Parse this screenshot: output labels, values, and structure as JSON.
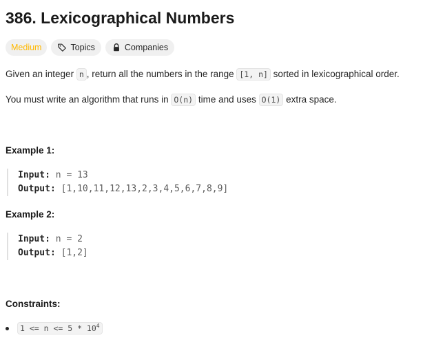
{
  "problem": {
    "title": "386. Lexicographical Numbers",
    "difficulty": "Medium",
    "topics_label": "Topics",
    "companies_label": "Companies"
  },
  "description": {
    "p1": {
      "t1": "Given an integer ",
      "c1": "n",
      "t2": ", return all the numbers in the range ",
      "c2": "[1, n]",
      "t3": " sorted in lexicographical order."
    },
    "p2": {
      "t1": "You must write an algorithm that runs in ",
      "c1": "O(n)",
      "t2": " time and uses ",
      "c2": "O(1)",
      "t3": " extra space."
    }
  },
  "examples": [
    {
      "heading": "Example 1:",
      "input_label": "Input:",
      "input_value": " n = 13",
      "output_label": "Output:",
      "output_value": " [1,10,11,12,13,2,3,4,5,6,7,8,9]"
    },
    {
      "heading": "Example 2:",
      "input_label": "Input:",
      "input_value": " n = 2",
      "output_label": "Output:",
      "output_value": " [1,2]"
    }
  ],
  "constraints": {
    "heading": "Constraints:",
    "items": [
      {
        "base": "1 <= n <= 5 * 10",
        "exp": "4"
      }
    ]
  },
  "colors": {
    "difficulty_medium": "#ffb800",
    "tag_bg": "#f0f0f0",
    "code_bg": "#f3f3f3"
  },
  "icons": {
    "topics": "tag-icon",
    "companies": "lock-icon"
  }
}
